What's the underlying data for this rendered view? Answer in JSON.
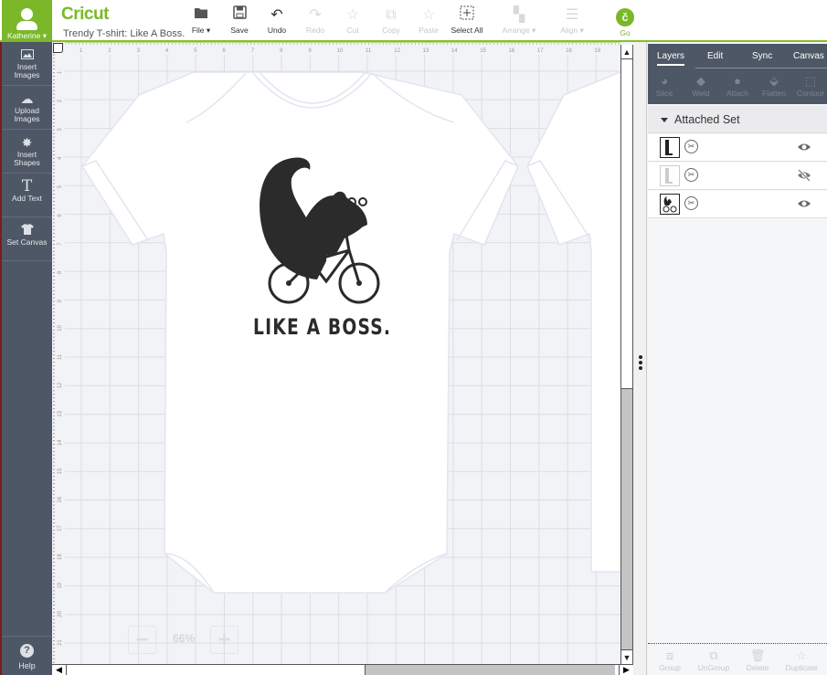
{
  "header": {
    "user_name": "Katherine",
    "logo": "Cricut",
    "project_title": "Trendy T-shirt: Like A Boss.",
    "toolbar": [
      {
        "label": "File",
        "icon": "folder-icon",
        "enabled": true,
        "dropdown": true
      },
      {
        "label": "Save",
        "icon": "save-icon",
        "enabled": true
      },
      {
        "label": "Undo",
        "icon": "undo-icon",
        "enabled": true
      },
      {
        "label": "Redo",
        "icon": "redo-icon",
        "enabled": false
      },
      {
        "label": "Cut",
        "icon": "cut-icon",
        "enabled": false
      },
      {
        "label": "Copy",
        "icon": "copy-icon",
        "enabled": false
      },
      {
        "label": "Paste",
        "icon": "paste-icon",
        "enabled": false
      },
      {
        "label": "Select All",
        "icon": "select-all-icon",
        "enabled": true
      },
      {
        "label": "Arrange",
        "icon": "arrange-icon",
        "enabled": false,
        "dropdown": true
      },
      {
        "label": "Align",
        "icon": "align-icon",
        "enabled": false,
        "dropdown": true
      }
    ],
    "go_label": "Go",
    "go_glyph": "č"
  },
  "leftnav": {
    "items": [
      {
        "label1": "Insert",
        "label2": "Images",
        "icon": "image-icon"
      },
      {
        "label1": "Upload",
        "label2": "Images",
        "icon": "cloud-upload-icon"
      },
      {
        "label1": "Insert",
        "label2": "Shapes",
        "icon": "shapes-icon"
      },
      {
        "label1": "Add Text",
        "label2": "",
        "icon": "text-icon"
      },
      {
        "label1": "Set Canvas",
        "label2": "",
        "icon": "tshirt-icon"
      }
    ],
    "help_label": "Help"
  },
  "canvas": {
    "ruler_h": [
      "1",
      "2",
      "3",
      "4",
      "5",
      "6",
      "7",
      "8",
      "9",
      "10",
      "11",
      "12",
      "13",
      "14",
      "15",
      "16",
      "17",
      "18",
      "19"
    ],
    "ruler_v": [
      "1",
      "2",
      "3",
      "4",
      "5",
      "6",
      "7",
      "8",
      "9",
      "10",
      "11",
      "12",
      "13",
      "14",
      "15",
      "16",
      "17",
      "18",
      "19",
      "20",
      "21"
    ],
    "design_text": "LIKE A BOSS.",
    "zoom_level": "66%",
    "zoom_out": "−",
    "zoom_in": "+"
  },
  "panel": {
    "tabs": [
      "Layers",
      "Edit",
      "Sync",
      "Canvas"
    ],
    "active_tab": "Layers",
    "tools": [
      "Slice",
      "Weld",
      "Attach",
      "Flatten",
      "Contour"
    ],
    "group_title": "Attached Set",
    "layers": [
      {
        "thumb": "L-shape",
        "visible": true
      },
      {
        "thumb": "L-shape",
        "visible": false
      },
      {
        "thumb": "squirrel-bike",
        "visible": true
      }
    ],
    "bottom_tools": [
      "Group",
      "UnGroup",
      "Delete",
      "Duplicate"
    ]
  },
  "colors": {
    "brand_green": "#7ab829",
    "nav_bg": "#4e5766",
    "design_fill": "#2b2b2b"
  }
}
